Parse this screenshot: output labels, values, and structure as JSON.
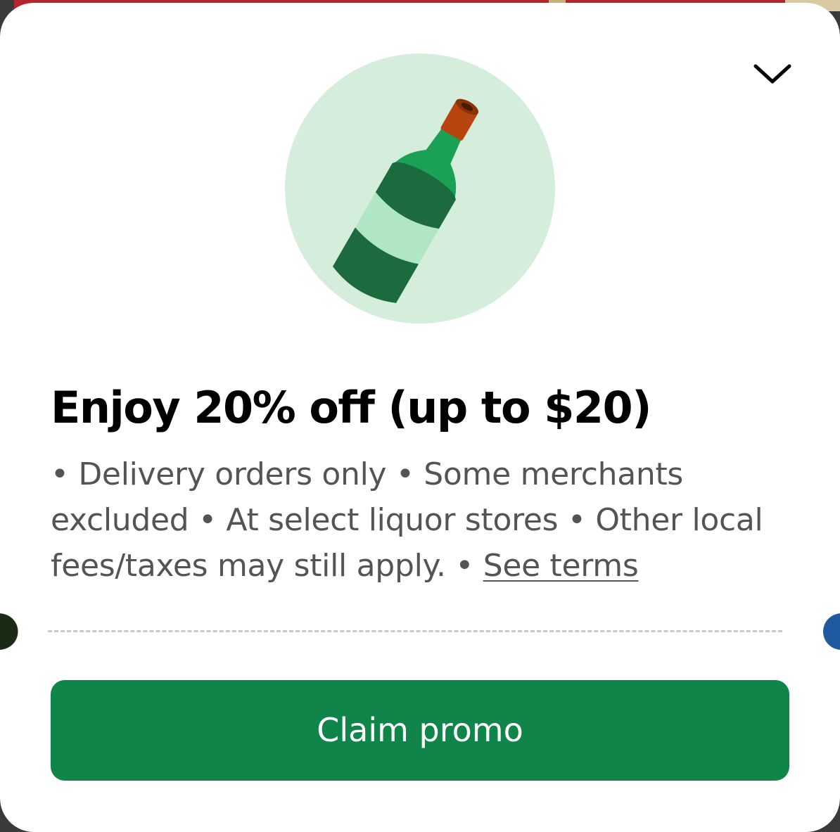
{
  "background": {
    "accent_red": "#b8242e",
    "left_dark": "#1b2a14",
    "right_blue": "#1e5aa0"
  },
  "sheet": {
    "collapse_icon": "chevron-down-icon",
    "hero_icon": "wine-bottle-icon",
    "hero_circle_color": "#d5eedb"
  },
  "promo": {
    "title": "Enjoy 20% off (up to $20)",
    "details_bullet_1": " • Delivery orders only",
    "details_bullet_2": " • Some merchants excluded",
    "details_bullet_3": " • At select liquor stores",
    "details_bullet_4": " • Other local fees/taxes may still apply.",
    "details_sep": " • ",
    "terms_link": "See terms"
  },
  "actions": {
    "claim_label": "Claim promo",
    "claim_color": "#10854a"
  }
}
